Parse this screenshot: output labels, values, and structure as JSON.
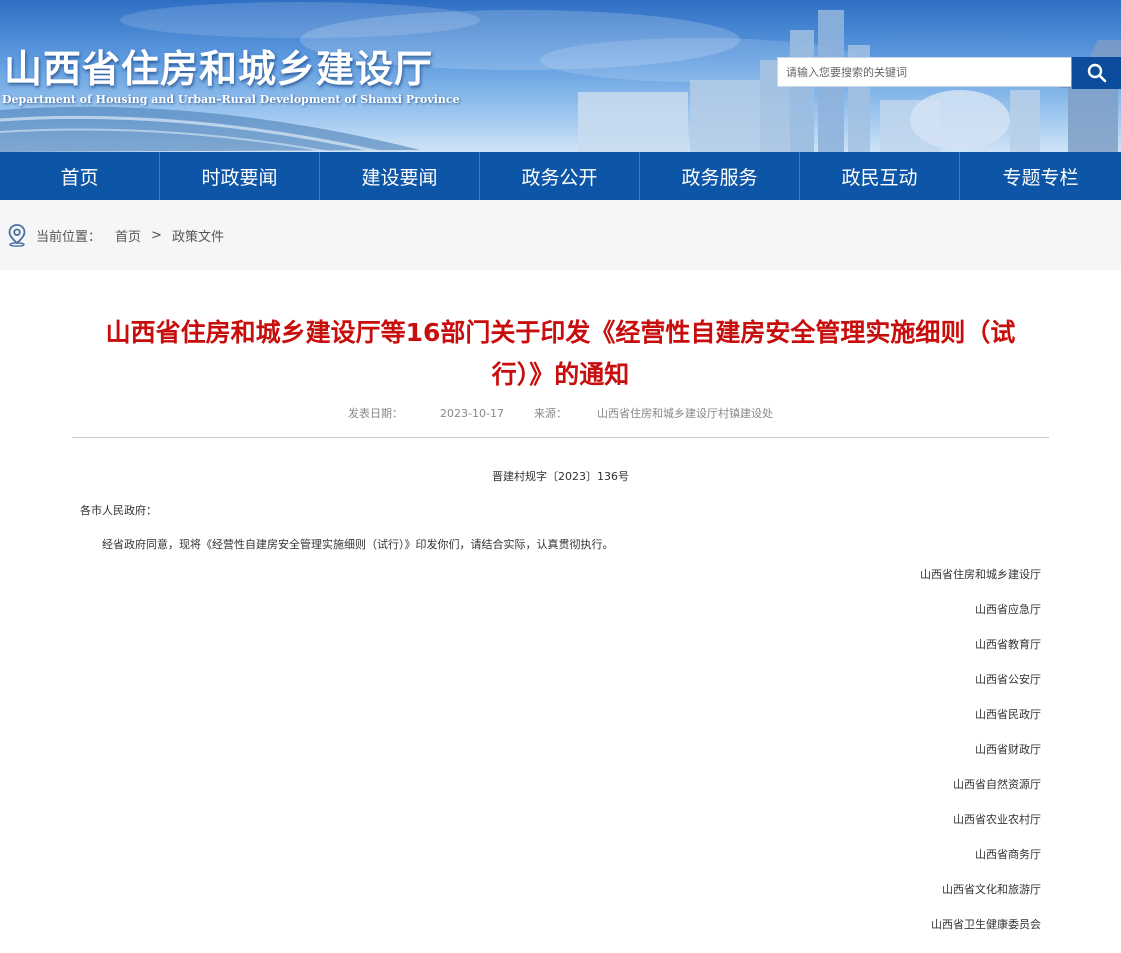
{
  "header": {
    "site_title": "山西省住房和城乡建设厅",
    "site_subtitle": "Department of Housing and Urban–Rural Development of Shanxi Province",
    "search_placeholder": "请输入您要搜索的关键词",
    "search_icon": "search-icon"
  },
  "nav": {
    "items": [
      {
        "label": "首页"
      },
      {
        "label": "时政要闻"
      },
      {
        "label": "建设要闻"
      },
      {
        "label": "政务公开"
      },
      {
        "label": "政务服务"
      },
      {
        "label": "政民互动"
      },
      {
        "label": "专题专栏"
      }
    ]
  },
  "breadcrumb": {
    "icon": "location-pin-icon",
    "prefix": "当前位置：",
    "home": "首页",
    "separator": ">",
    "current": "政策文件"
  },
  "article": {
    "title": "山西省住房和城乡建设厅等16部门关于印发《经营性自建房安全管理实施细则（试行）》的通知",
    "publish_date_label": "发表日期：",
    "publish_date": "2023-10-17",
    "source_label": "来源：",
    "source": "山西省住房和城乡建设厅村镇建设处",
    "doc_number": "晋建村规字〔2023〕136号",
    "salutation": "各市人民政府：",
    "body": "经省政府同意，现将《经营性自建房安全管理实施细则（试行）》印发你们，请结合实际，认真贯彻执行。",
    "signers": [
      "山西省住房和城乡建设厅",
      "山西省应急厅",
      "山西省教育厅",
      "山西省公安厅",
      "山西省民政厅",
      "山西省财政厅",
      "山西省自然资源厅",
      "山西省农业农村厅",
      "山西省商务厅",
      "山西省文化和旅游厅",
      "山西省卫生健康委员会"
    ]
  },
  "colors": {
    "nav_bg": "#0d55a6",
    "title_red": "#c80d0d",
    "search_button": "#0b4c9c"
  }
}
